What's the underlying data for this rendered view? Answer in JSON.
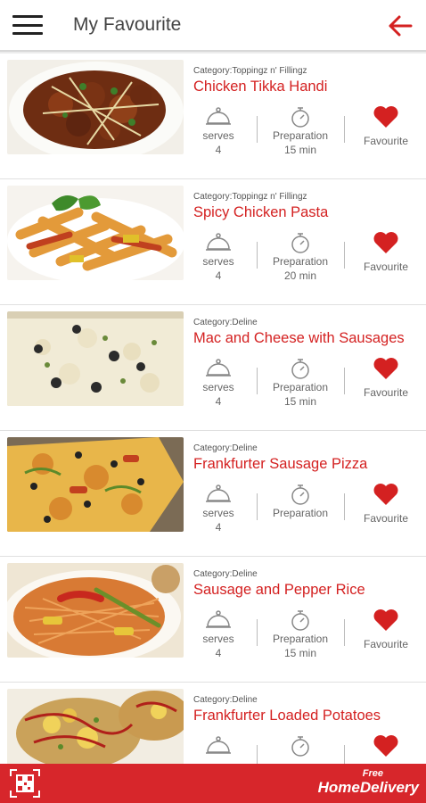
{
  "header": {
    "title": "My Favourite",
    "menu_icon": "hamburger-menu-icon",
    "back_icon": "back-arrow-icon"
  },
  "stat_labels": {
    "serves": "serves",
    "preparation": "Preparation",
    "favourite": "Favourite"
  },
  "recipes": [
    {
      "category": "Category:Toppingz n' Fillingz",
      "name": "Chicken Tikka Handi",
      "serves": "4",
      "prep": "15 min"
    },
    {
      "category": "Category:Toppingz n' Fillingz",
      "name": "Spicy Chicken Pasta",
      "serves": "4",
      "prep": "20 min"
    },
    {
      "category": "Category:Deline",
      "name": "Mac and Cheese with Sausages",
      "serves": "4",
      "prep": "15 min"
    },
    {
      "category": "Category:Deline",
      "name": "Frankfurter Sausage Pizza",
      "serves": "4",
      "prep": ""
    },
    {
      "category": "Category:Deline",
      "name": "Sausage and Pepper Rice",
      "serves": "4",
      "prep": "15 min"
    },
    {
      "category": "Category:Deline",
      "name": "Frankfurter Loaded Potatoes",
      "serves": "",
      "prep": ""
    }
  ],
  "footer": {
    "promo_small": "Free",
    "promo_big": "HomeDelivery",
    "qr_icon": "qr-code-icon"
  },
  "colors": {
    "accent": "#d42121",
    "footer": "#d7262b"
  }
}
